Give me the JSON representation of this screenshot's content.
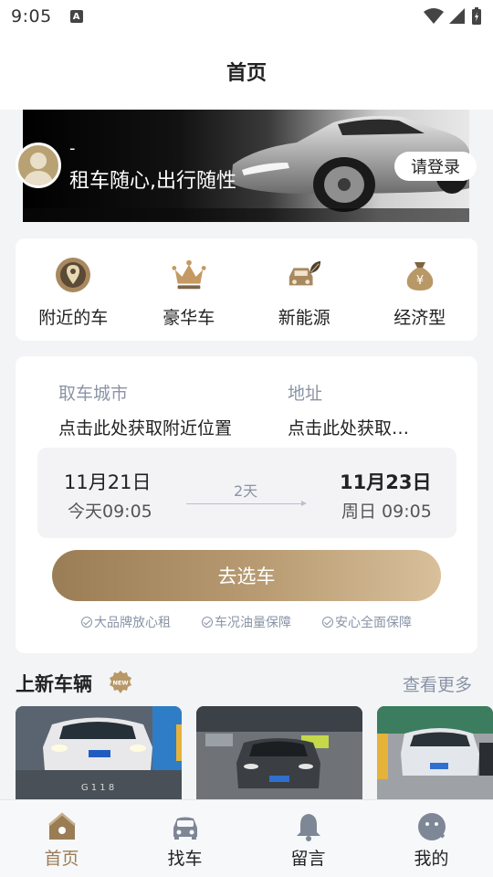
{
  "status_bar": {
    "time": "9:05",
    "notification_letter": "A"
  },
  "header": {
    "title": "首页"
  },
  "banner": {
    "user_name": "-",
    "slogan": "租车随心,出行随性",
    "login_label": "请登录"
  },
  "categories": [
    {
      "label": "附近的车",
      "icon": "location-pin-icon"
    },
    {
      "label": "豪华车",
      "icon": "crown-icon"
    },
    {
      "label": "新能源",
      "icon": "eco-car-icon"
    },
    {
      "label": "经济型",
      "icon": "money-bag-icon"
    }
  ],
  "rental": {
    "city_label": "取车城市",
    "city_value": "点击此处获取附近位置",
    "address_label": "地址",
    "address_value": "点击此处获取…",
    "pickup_date": "11月21日",
    "pickup_time": "今天09:05",
    "duration": "2天",
    "return_date": "11月23日",
    "return_time": "周日 09:05",
    "select_button": "去选车",
    "guarantees": [
      "大品牌放心租",
      "车况油量保障",
      "安心全面保障"
    ]
  },
  "new_cars": {
    "title": "上新车辆",
    "badge": "NEW",
    "more_label": "查看更多"
  },
  "tabs": [
    {
      "label": "首页",
      "icon": "home-icon",
      "active": true
    },
    {
      "label": "找车",
      "icon": "car-icon",
      "active": false
    },
    {
      "label": "留言",
      "icon": "bell-icon",
      "active": false
    },
    {
      "label": "我的",
      "icon": "profile-icon",
      "active": false
    }
  ],
  "colors": {
    "accent_gold": "#9a7d55",
    "muted_text": "#8a94a6",
    "background": "#f3f4f6"
  }
}
